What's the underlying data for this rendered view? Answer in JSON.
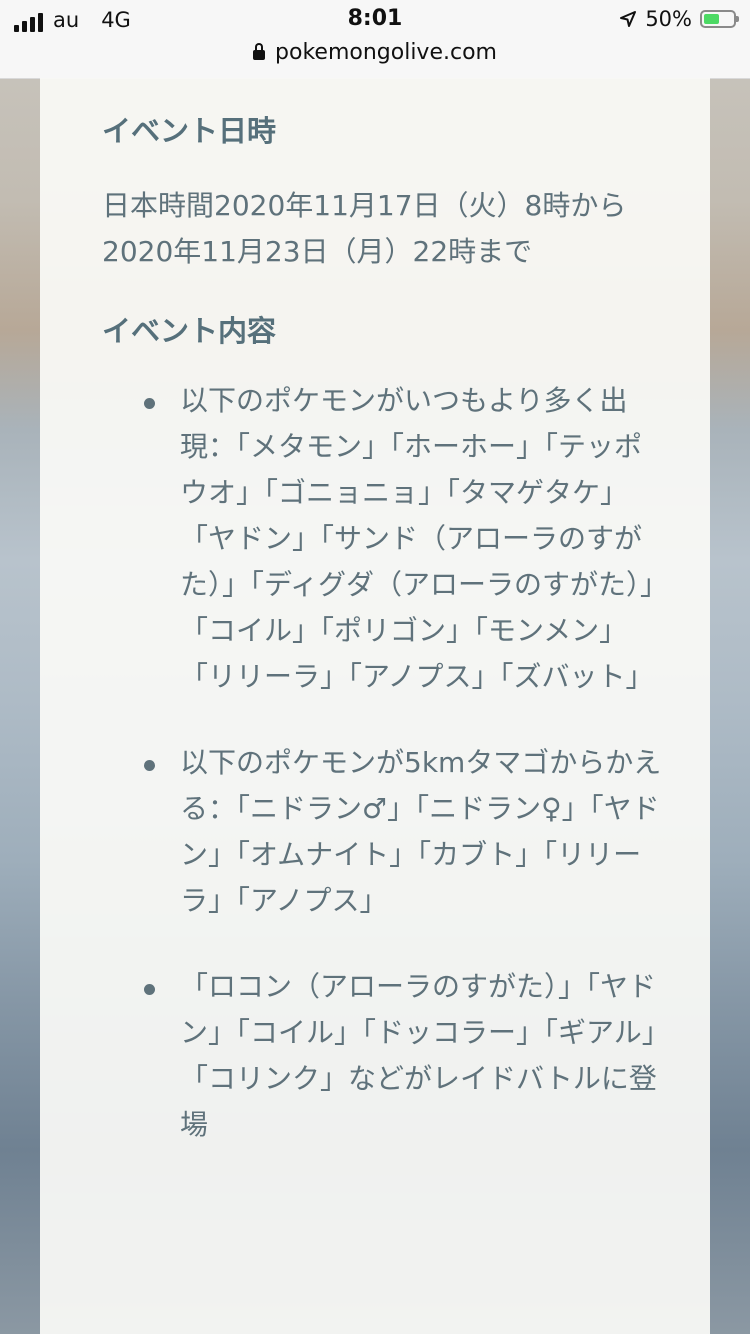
{
  "status_bar": {
    "carrier": "au",
    "network": "4G",
    "time": "8:01",
    "battery_percent": "50%",
    "url": "pokemongolive.com"
  },
  "article": {
    "heading_date": "イベント日時",
    "date_text": "日本時間2020年11月17日（火）8時から2020年11月23日（月）22時まで",
    "heading_content": "イベント内容",
    "bullets": [
      "以下のポケモンがいつもより多く出現：「メタモン」「ホーホー」「テッポウオ」「ゴニョニョ」「タマゲタケ」「ヤドン」「サンド（アローラのすがた）」「ディグダ（アローラのすがた）」「コイル」「ポリゴン」「モンメン」「リリーラ」「アノプス」「ズバット」",
      "以下のポケモンが5kmタマゴからかえる：「ニドラン♂」「ニドラン♀」「ヤドン」「オムナイト」「カブト」「リリーラ」「アノプス」",
      "「ロコン（アローラのすがた）」「ヤドン」「コイル」「ドッコラー」「ギアル」「コリンク」などがレイドバトルに登場"
    ]
  },
  "colors": {
    "text": "#5f727b",
    "heading": "#56707b",
    "battery_green": "#4cd964"
  }
}
